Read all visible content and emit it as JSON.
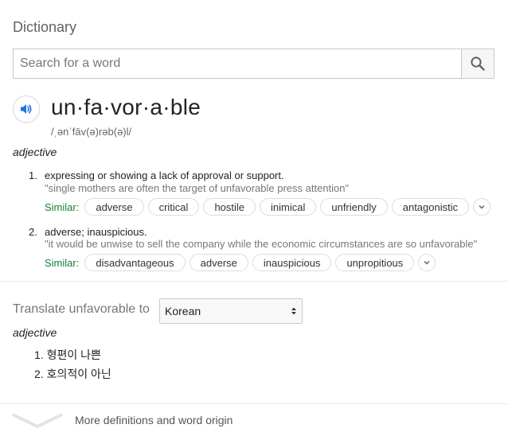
{
  "panel": {
    "title": "Dictionary"
  },
  "search": {
    "placeholder": "Search for a word",
    "value": ""
  },
  "entry": {
    "headword": "un·fa·vor·a·ble",
    "phonetic": "/ˌənˈfāv(ə)rəb(ə)l/",
    "part_of_speech": "adjective",
    "senses": [
      {
        "number": "1.",
        "definition": "expressing or showing a lack of approval or support.",
        "example": "\"single mothers are often the target of unfavorable press attention\"",
        "similar_label": "Similar:",
        "similar": [
          "adverse",
          "critical",
          "hostile",
          "inimical",
          "unfriendly",
          "antagonistic"
        ]
      },
      {
        "number": "2.",
        "definition": "adverse; inauspicious.",
        "example": "\"it would be unwise to sell the company while the economic circumstances are so unfavorable\"",
        "similar_label": "Similar:",
        "similar": [
          "disadvantageous",
          "adverse",
          "inauspicious",
          "unpropitious"
        ]
      }
    ]
  },
  "translate": {
    "label": "Translate unfavorable to",
    "language": "Korean",
    "part_of_speech": "adjective",
    "items": [
      "1. 형편이 나쁜",
      "2. 호의적이 아닌"
    ]
  },
  "footer": {
    "label": "More definitions and word origin"
  },
  "colors": {
    "similar_label": "#188038",
    "speaker_icon": "#1a73e8",
    "border": "#dadce0"
  },
  "icons": [
    "search-icon",
    "speaker-icon",
    "chevron-down-icon",
    "select-arrows-icon",
    "expand-chevron-icon"
  ]
}
